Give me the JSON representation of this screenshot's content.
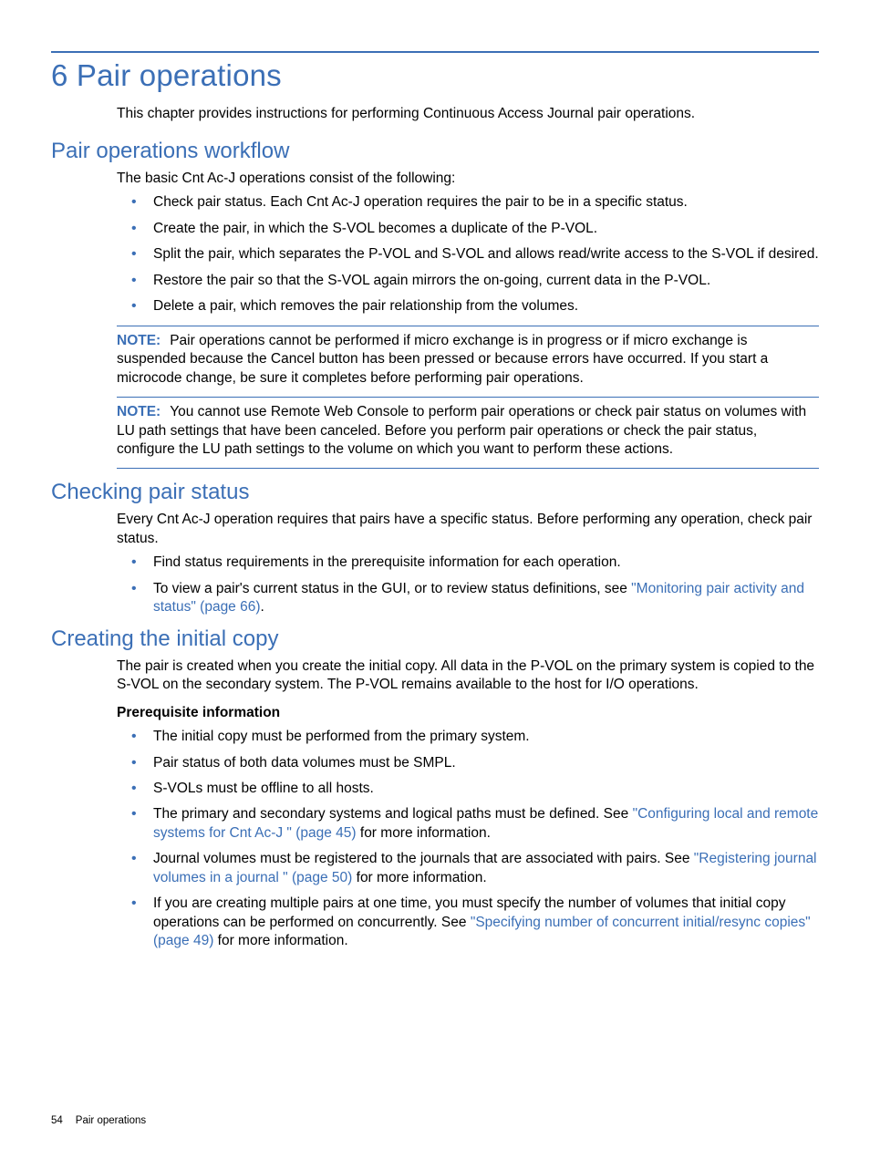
{
  "chapter_title": "6 Pair operations",
  "intro": "This chapter provides instructions for performing Continuous Access Journal pair operations.",
  "sections": {
    "workflow": {
      "heading": "Pair operations workflow",
      "lead": "The basic Cnt Ac-J operations consist of the following:",
      "items": [
        "Check pair status. Each Cnt Ac-J operation requires the pair to be in a specific status.",
        "Create the pair, in which the S-VOL becomes a duplicate of the P-VOL.",
        "Split the pair, which separates the P-VOL and S-VOL and allows read/write access to the S-VOL if desired.",
        "Restore the pair so that the S-VOL again mirrors the on-going, current data in the P-VOL.",
        "Delete a pair, which removes the pair relationship from the volumes."
      ],
      "note1_label": "NOTE:",
      "note1_body": "Pair operations cannot be performed if micro exchange is in progress or if micro exchange is suspended because the Cancel button has been pressed or because errors have occurred. If you start a microcode change, be sure it completes before performing pair operations.",
      "note2_label": "NOTE:",
      "note2_body": "You cannot use Remote Web Console to perform pair operations or check pair status on volumes with LU path settings that have been canceled. Before you perform pair operations or check the pair status, configure the LU path settings to the volume on which you want to perform these actions."
    },
    "checking": {
      "heading": "Checking pair status",
      "lead": "Every Cnt Ac-J operation requires that pairs have a specific status. Before performing any operation, check pair status.",
      "items": {
        "i0": "Find status requirements in the prerequisite information for each operation.",
        "i1_pre": "To view a pair's current status in the GUI, or to review status definitions, see ",
        "i1_link": "\"Monitoring pair activity and status\" (page 66)",
        "i1_post": "."
      }
    },
    "creating": {
      "heading": "Creating the initial copy",
      "lead": "The pair is created when you create the initial copy. All data in the P-VOL on the primary system is copied to the S-VOL on the secondary system. The P-VOL remains available to the host for I/O operations.",
      "subhead": "Prerequisite information",
      "items": {
        "i0": "The initial copy must be performed from the primary system.",
        "i1": "Pair status of both data volumes must be SMPL.",
        "i2": "S-VOLs must be offline to all hosts.",
        "i3_pre": "The primary and secondary systems and logical paths must be defined. See ",
        "i3_link": "\"Configuring local and remote systems for Cnt Ac-J \" (page 45)",
        "i3_post": " for more information.",
        "i4_pre": "Journal volumes must be registered to the journals that are associated with pairs. See ",
        "i4_link": "\"Registering journal volumes in a journal \" (page 50)",
        "i4_post": " for more information.",
        "i5_pre": "If you are creating multiple pairs at one time, you must specify the number of volumes that initial copy operations can be performed on concurrently. See ",
        "i5_link": "\"Specifying number of concurrent initial/resync copies\" (page 49)",
        "i5_post": " for more information."
      }
    }
  },
  "footer": {
    "page_number": "54",
    "section_name": "Pair operations"
  }
}
